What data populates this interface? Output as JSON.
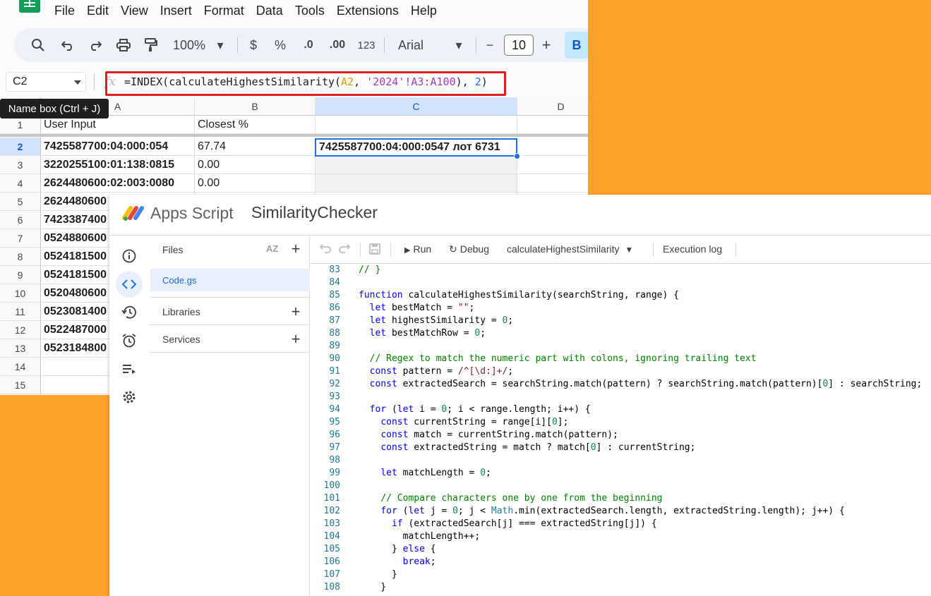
{
  "sheets": {
    "menu": [
      "File",
      "Edit",
      "View",
      "Insert",
      "Format",
      "Data",
      "Tools",
      "Extensions",
      "Help"
    ],
    "toolbar": {
      "zoom": "100%",
      "currency": "$",
      "percent": "%",
      "dec_decrease": ".0",
      "dec_increase": ".00",
      "number_format": "123",
      "font": "Arial",
      "font_size": "10",
      "minus": "−",
      "plus": "+",
      "bold": "B"
    },
    "name_box": "C2",
    "formula": {
      "prefix": "=INDEX(calculateHighestSimilarity(",
      "ref1": "A2",
      "sep1": ", ",
      "ref2": "'2024'!A3:A100",
      "sep2": "), ",
      "num": "2",
      "suffix": ")"
    },
    "tooltip": "Name box (Ctrl + J)",
    "columns": [
      "A",
      "B",
      "C",
      "D"
    ],
    "row_numbers": [
      "1",
      "2",
      "3",
      "4",
      "5",
      "6",
      "7",
      "8",
      "9",
      "10",
      "11",
      "12",
      "13",
      "14",
      "15"
    ],
    "header_row": {
      "a": "User Input",
      "b": "Closest %"
    },
    "rows": [
      {
        "a": "7425587700:04:000:054",
        "b": "67.74"
      },
      {
        "a": "3220255100:01:138:0815",
        "b": "0.00"
      },
      {
        "a": "2624480600:02:003:0080",
        "b": "0.00"
      },
      {
        "a": "2624480600",
        "b": ""
      },
      {
        "a": "7423387400",
        "b": ""
      },
      {
        "a": "0524880600",
        "b": ""
      },
      {
        "a": "0524181500",
        "b": ""
      },
      {
        "a": "0524181500",
        "b": ""
      },
      {
        "a": "0520480600",
        "b": ""
      },
      {
        "a": "0523081400",
        "b": ""
      },
      {
        "a": "0522487000",
        "b": ""
      },
      {
        "a": "0523184800",
        "b": ""
      }
    ],
    "active_cell_value": "7425587700:04:000:0547 лот 6731"
  },
  "apps_script": {
    "brand": "Apps Script",
    "project_title": "SimilarityChecker",
    "files_label": "Files",
    "sort_label": "AZ",
    "file": "Code.gs",
    "libraries_label": "Libraries",
    "services_label": "Services",
    "run_label": "Run",
    "debug_label": "Debug",
    "function_select": "calculateHighestSimilarity",
    "execution_log_label": "Execution log",
    "code_lines": [
      {
        "n": "83",
        "t": "// }"
      },
      {
        "n": "84",
        "t": ""
      },
      {
        "n": "85",
        "t": "function calculateHighestSimilarity(searchString, range) {"
      },
      {
        "n": "86",
        "t": "  let bestMatch = \"\";"
      },
      {
        "n": "87",
        "t": "  let highestSimilarity = 0;"
      },
      {
        "n": "88",
        "t": "  let bestMatchRow = 0;"
      },
      {
        "n": "89",
        "t": ""
      },
      {
        "n": "90",
        "t": "  // Regex to match the numeric part with colons, ignoring trailing text"
      },
      {
        "n": "91",
        "t": "  const pattern = /^[\\d:]+/;"
      },
      {
        "n": "92",
        "t": "  const extractedSearch = searchString.match(pattern) ? searchString.match(pattern)[0] : searchString;"
      },
      {
        "n": "93",
        "t": ""
      },
      {
        "n": "94",
        "t": "  for (let i = 0; i < range.length; i++) {"
      },
      {
        "n": "95",
        "t": "    const currentString = range[i][0];"
      },
      {
        "n": "96",
        "t": "    const match = currentString.match(pattern);"
      },
      {
        "n": "97",
        "t": "    const extractedString = match ? match[0] : currentString;"
      },
      {
        "n": "98",
        "t": ""
      },
      {
        "n": "99",
        "t": "    let matchLength = 0;"
      },
      {
        "n": "100",
        "t": ""
      },
      {
        "n": "101",
        "t": "    // Compare characters one by one from the beginning"
      },
      {
        "n": "102",
        "t": "    for (let j = 0; j < Math.min(extractedSearch.length, extractedString.length); j++) {"
      },
      {
        "n": "103",
        "t": "      if (extractedSearch[j] === extractedString[j]) {"
      },
      {
        "n": "104",
        "t": "        matchLength++;"
      },
      {
        "n": "105",
        "t": "      } else {"
      },
      {
        "n": "106",
        "t": "        break;"
      },
      {
        "n": "107",
        "t": "      }"
      },
      {
        "n": "108",
        "t": "    }"
      }
    ]
  },
  "colors": {
    "background": "#ffa229",
    "formula_highlight": "#e01e1e",
    "selection": "#1a73e8",
    "sheets_green": "#0f9d58"
  }
}
